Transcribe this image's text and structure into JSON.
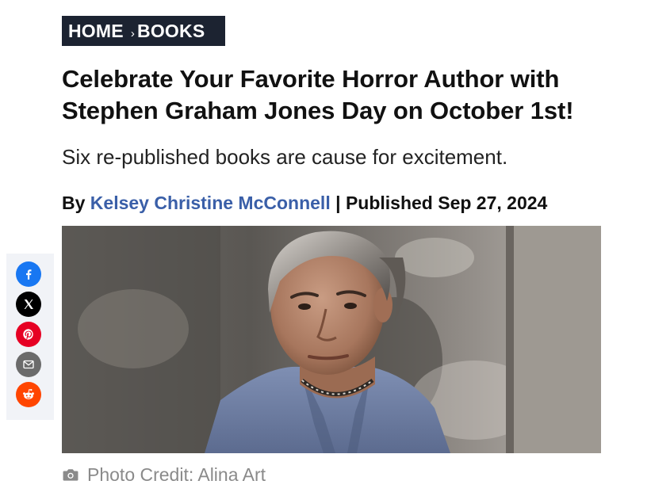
{
  "breadcrumb": {
    "home": "HOME",
    "separator": "›",
    "section": "BOOKS"
  },
  "article": {
    "headline": "Celebrate Your Favorite Horror Author with Stephen Graham Jones Day on October 1st!",
    "subtitle": "Six re-published books are cause for excitement.",
    "byline_prefix": "By",
    "author": "Kelsey Christine McConnell",
    "byline_separator": "|",
    "published_label": "Published",
    "published_date": "Sep 27, 2024"
  },
  "hero": {
    "caption_icon": "camera-icon",
    "caption": "Photo Credit: Alina Art"
  },
  "share": [
    {
      "name": "facebook",
      "icon": "facebook-icon",
      "color": "#1877f2"
    },
    {
      "name": "x",
      "icon": "x-icon",
      "color": "#000000"
    },
    {
      "name": "pinterest",
      "icon": "pinterest-icon",
      "color": "#e60023"
    },
    {
      "name": "email",
      "icon": "email-icon",
      "color": "#6b6b6b"
    },
    {
      "name": "reddit",
      "icon": "reddit-icon",
      "color": "#ff4500"
    }
  ],
  "colors": {
    "breadcrumb_bg": "#1c2331",
    "author_link": "#3a5fa8",
    "caption_text": "#8a8a8a",
    "share_rail_bg": "#f1f3f7"
  }
}
